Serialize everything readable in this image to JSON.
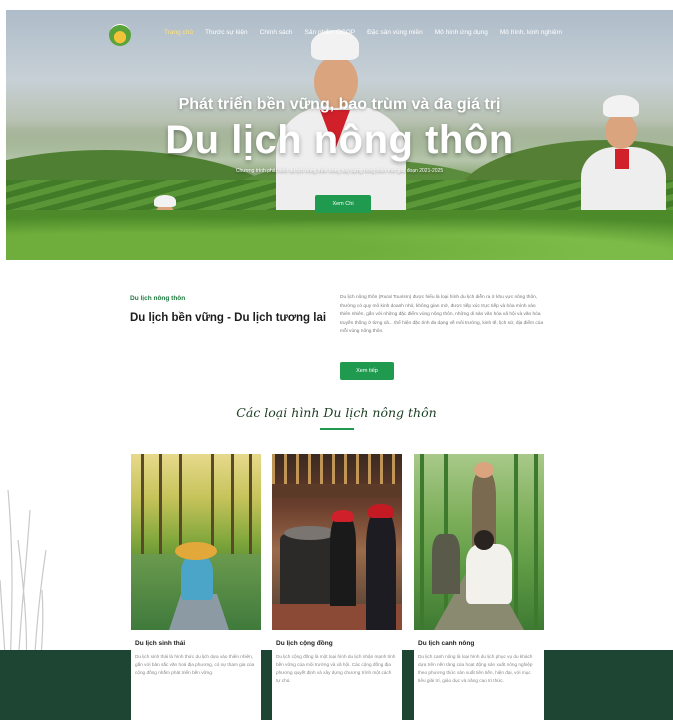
{
  "nav": {
    "items": [
      {
        "label": "Trang chủ",
        "active": true
      },
      {
        "label": "Thước sự kiện",
        "active": false
      },
      {
        "label": "Chính sách",
        "active": false
      },
      {
        "label": "Sản phẩm OCOP",
        "active": false
      },
      {
        "label": "Đặc sản vùng miền",
        "active": false
      },
      {
        "label": "Mô hình ứng dụng",
        "active": false
      },
      {
        "label": "Mô hình, kinh nghiệm",
        "active": false
      }
    ]
  },
  "hero": {
    "subtitle": "Phát triển bền vững, bao trùm và đa giá trị",
    "title": "Du lịch nông thôn",
    "description": "Chương trình phát triển du lịch nông thôn trong xây dựng nông thôn mới giai đoạn 2021-2025",
    "button_label": "Xem Chi"
  },
  "intro": {
    "kicker": "Du lịch nông thôn",
    "heading": "Du lịch bền vững - Du lịch tương lai",
    "body": "Du lịch nông thôn (Rural Tourism) được hiểu là loại hình du lịch diễn ra ở khu vực nông thôn, thường có quy mô kinh doanh nhỏ, không gian mở, được tiếp xúc trực tiếp và hòa mình vào thiên nhiên, gắn với những đặc điểm vùng nông thôn, những di sản văn hóa xã hội và văn hóa truyền thống ở từng xã... thể hiện đặc tính đa dạng về môi trường, kinh tế, lịch sử, địa điểm của mỗi vùng nông thôn.",
    "button_label": "Xem tiếp"
  },
  "types_section": {
    "title": "Các loại hình Du lịch nông thôn"
  },
  "cards": [
    {
      "title": "Du lịch sinh thái",
      "description": "Du lịch sinh thái là hình thức du lịch dựa vào thiên nhiên, gắn với bản sắc văn hoá địa phương, có sự tham gia của cộng đồng nhằm phát triển bền vững."
    },
    {
      "title": "Du lịch cộng đồng",
      "description": "Du lịch cộng đồng là một loại hình du lịch nhận mạnh tính bền vững của môi trường và xã hội. Các cộng đồng địa phương quyết định và xây dựng chương trình một cách tự chủ."
    },
    {
      "title": "Du lịch canh nông",
      "description": "Du lịch canh nông là loại hình du lịch phục vụ du khách dựa trên nền tảng của hoạt động sản xuất nông nghiệp theo phương thức sản xuất tiên tiến, hiện đại, với mục tiêu giải trí, giáo dục và nâng cao tri thức."
    }
  ],
  "colors": {
    "accent_green": "#1f9a4f",
    "band_dark_green": "#1e4533",
    "title_dark": "#1b3d22"
  },
  "icons": {
    "logo": "lotus-logo-icon"
  }
}
